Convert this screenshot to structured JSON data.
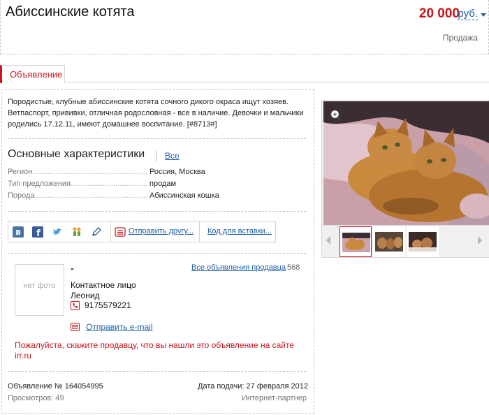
{
  "header": {
    "title": "Абиссинские котята",
    "price": "20 000",
    "currency": "руб.",
    "deal_type": "Продажа"
  },
  "tabs": [
    {
      "label": "Объявление",
      "active": true
    }
  ],
  "description": "Породистые, клубные абиссинские котята сочного дикого окраса ищут хозяев. Ветпаспорт, прививки, отличная родословная - все в наличие. Девочки и мальчики родились 17.12.11, имеют домашнее воспитание. [#8713#]",
  "characteristics": {
    "title": "Основные характеристики",
    "all_link": "Все",
    "rows": [
      {
        "key": "Регион",
        "value": "Россия, Москва"
      },
      {
        "key": "Тип предложения",
        "value": "продам"
      },
      {
        "key": "Порода",
        "value": "Абиссинская кошка"
      }
    ]
  },
  "share": {
    "icons": [
      "vkontakte-icon",
      "facebook-icon",
      "twitter-icon",
      "odnoklassniki-icon",
      "livejournal-icon",
      "mail-icon"
    ],
    "send_friend": "Отправить другу...",
    "embed_code": "Код для вставки..."
  },
  "seller": {
    "no_photo": "нет фото",
    "name": "-",
    "all_ads_link": "Все объявления продавца",
    "all_ads_count": "568",
    "contact_label": "Контактное лицо",
    "contact_name": "Леонид",
    "phone": "9175579221",
    "email_link": "Отправить e-mail",
    "notice": "Пожалуйста, скажите продавцу, что вы нашли это объявление на сайте irr.ru"
  },
  "footer": {
    "ad_number": "Объявление № 164054995",
    "views": "Просмотров: 49",
    "date": "Дата подачи: 27 февраля 2012",
    "partner": "Интернет-партнер"
  },
  "gallery": {
    "thumb_count": 3,
    "selected_index": 0
  },
  "colors": {
    "accent_red": "#c8161d",
    "link_blue": "#1f5fa8"
  }
}
